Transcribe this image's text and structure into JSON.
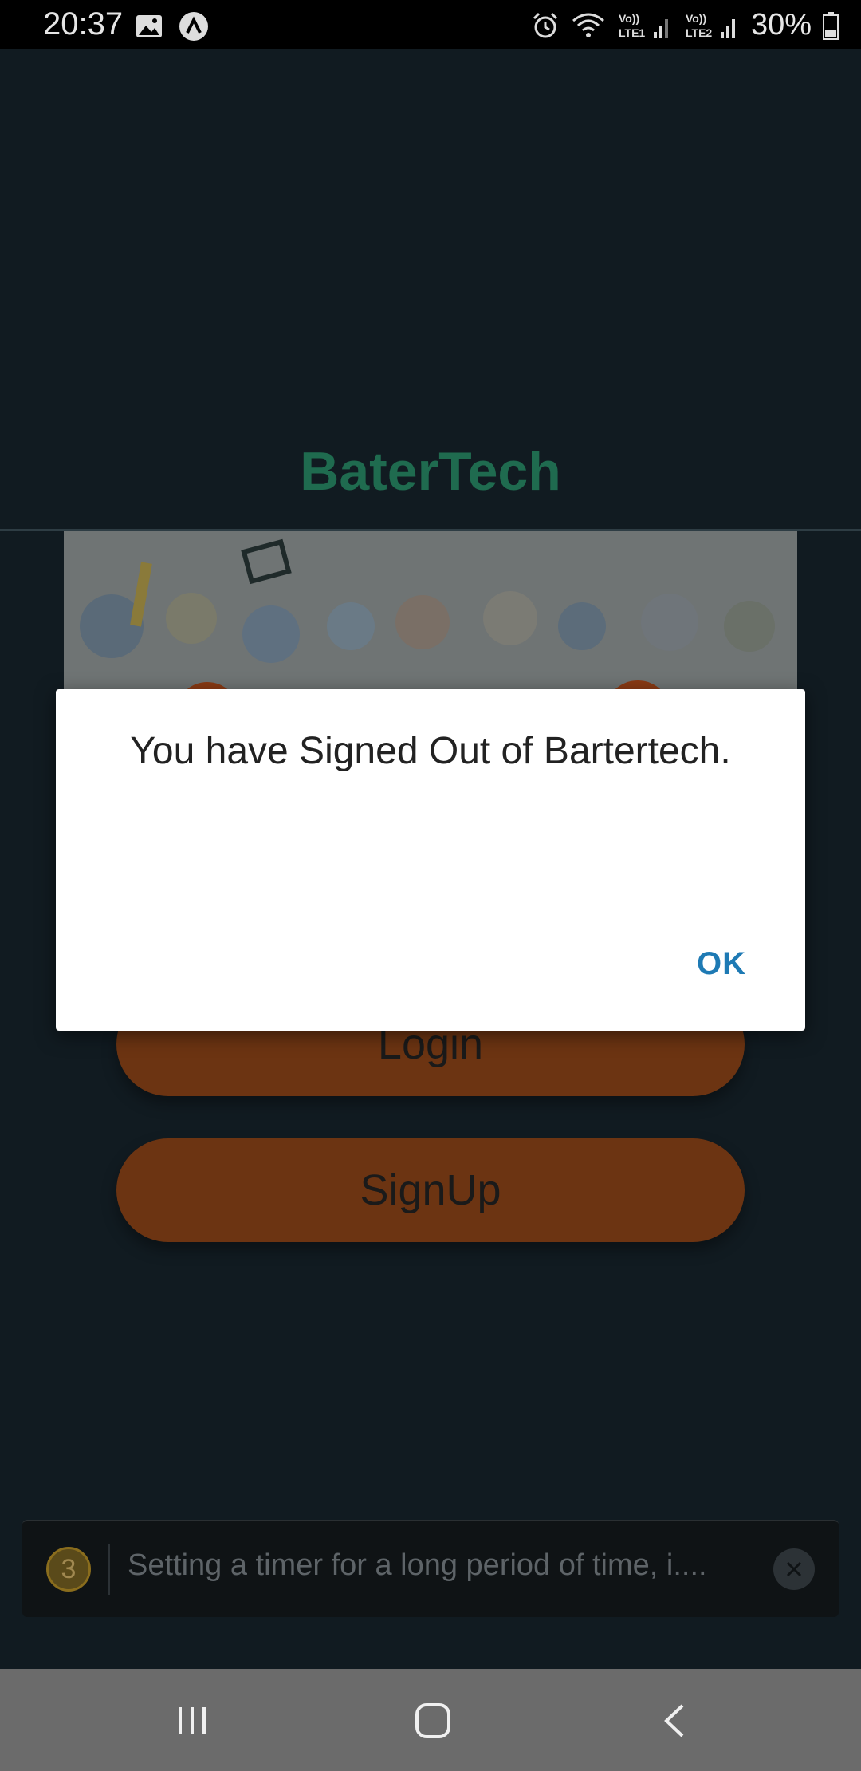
{
  "status_bar": {
    "time": "20:37",
    "battery": "30%",
    "icons": [
      "image-icon",
      "app-notification-icon",
      "alarm-icon",
      "wifi-icon",
      "lte1-signal-icon",
      "lte2-signal-icon",
      "battery-icon"
    ],
    "lte1_label": "Vo)) LTE1",
    "lte2_label": "Vo)) LTE2"
  },
  "app": {
    "title": "BaterTech",
    "title_color": "#1f6b4f",
    "buttons": {
      "login": "Login",
      "signup": "SignUp"
    },
    "button_color": "#6c3412"
  },
  "dialog": {
    "message": "You have Signed Out of Bartertech.",
    "ok_label": "OK",
    "ok_color": "#1e7ab4"
  },
  "toast": {
    "count": "3",
    "message": "Setting a timer for a long period of time, i...."
  },
  "nav_bar": {
    "icons": [
      "recent-apps-icon",
      "home-icon",
      "back-icon"
    ]
  }
}
